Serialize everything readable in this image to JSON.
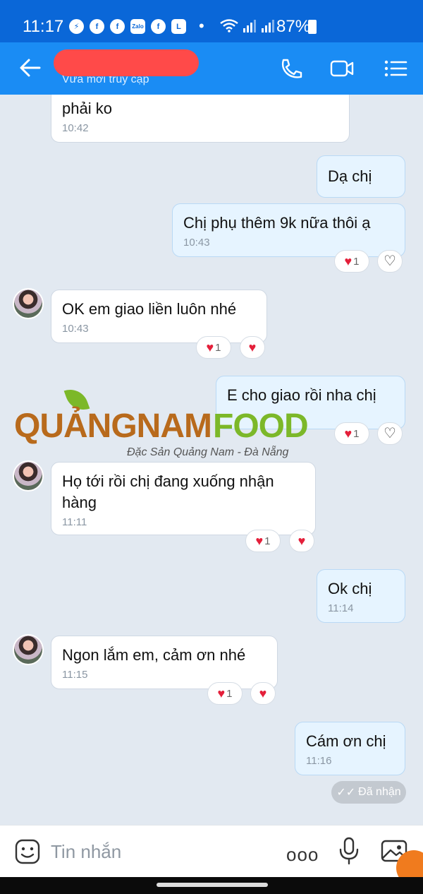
{
  "status_bar": {
    "time": "11:17",
    "battery_percent": "87%",
    "app_icons": [
      "messenger-icon",
      "facebook-icon",
      "facebook-icon",
      "zalo-icon",
      "facebook-icon",
      "l-app-icon"
    ],
    "zalo_text": "Zalo",
    "l_text": "L",
    "separator": "•"
  },
  "header": {
    "subtitle": "Vừa mới truy cập"
  },
  "messages": [
    {
      "side": "in",
      "text": "phải ko",
      "time": "10:42"
    },
    {
      "side": "out",
      "text": "Dạ chị",
      "time": ""
    },
    {
      "side": "out",
      "text": "Chị phụ thêm 9k nữa thôi ạ",
      "time": "10:43",
      "reaction_count": "1"
    },
    {
      "side": "in",
      "text": "OK em giao liền luôn nhé",
      "time": "10:43",
      "reaction_count": "1"
    },
    {
      "side": "out",
      "text": "E cho giao rồi nha chị",
      "time": "",
      "reaction_count": "1"
    },
    {
      "side": "in",
      "text": "Họ tới rồi chị đang xuống nhận hàng",
      "time": "11:11",
      "reaction_count": "1"
    },
    {
      "side": "out",
      "text": "Ok chị",
      "time": "11:14"
    },
    {
      "side": "in",
      "text": "Ngon lắm em, cảm ơn nhé",
      "time": "11:15",
      "reaction_count": "1"
    },
    {
      "side": "out",
      "text": "Cám ơn chị",
      "time": "11:16"
    }
  ],
  "watermark": {
    "brand_part1": "QUẢNGNAM",
    "brand_part2": "FOOD",
    "tagline": "Đặc Sản Quảng Nam - Đà Nẵng"
  },
  "delivery_status": "Đã nhận",
  "composer": {
    "placeholder": "Tin nhắn",
    "more_label": "ooo"
  },
  "colors": {
    "status_bar": "#0a67d8",
    "header": "#1a8cf4",
    "outgoing_bubble": "#e6f4ff",
    "incoming_bubble": "#ffffff",
    "chat_background": "#e2e9f1",
    "heart": "#e41f3a"
  }
}
